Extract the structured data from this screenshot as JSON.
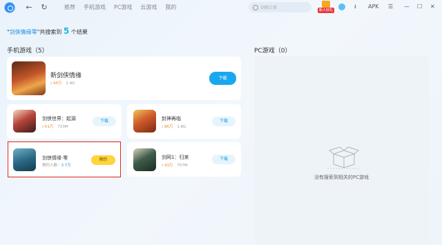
{
  "topbar": {
    "nav": [
      "推荐",
      "手机游戏",
      "PC游戏",
      "云游戏",
      "我的"
    ],
    "search_placeholder": "剑网三侠",
    "gift_badge": "新人好礼",
    "apk_label": "APK"
  },
  "search_result": {
    "prefix": "\"",
    "keyword": "剑侠情缘零",
    "middle": "\"共搜索到",
    "count": "5",
    "suffix": "个结果"
  },
  "mobile_section": {
    "title": "手机游戏（5）",
    "featured": {
      "name": "新剑侠情缘",
      "downloads": "44万",
      "size": "1.9G",
      "button": "下载"
    },
    "games": [
      {
        "name": "剑侠世界：起源",
        "downloads": "61万",
        "size": "723M",
        "button": "下载"
      },
      {
        "name": "封神再临",
        "downloads": "86万",
        "size": "1.8G",
        "button": "下载"
      },
      {
        "name": "剑侠情缘·零",
        "reserve_label": "预约人数：",
        "reserve_count": "3.7万",
        "button": "预约"
      },
      {
        "name": "剑网1：归来",
        "downloads": "43万",
        "size": "707M",
        "button": "下载"
      }
    ]
  },
  "pc_section": {
    "title": "PC游戏（0）",
    "empty_text": "没有搜索到相关的PC游戏"
  },
  "colors": {
    "accent": "#1aa7f0",
    "highlight_border": "#e2231a",
    "reserve": "#ffd43b"
  }
}
